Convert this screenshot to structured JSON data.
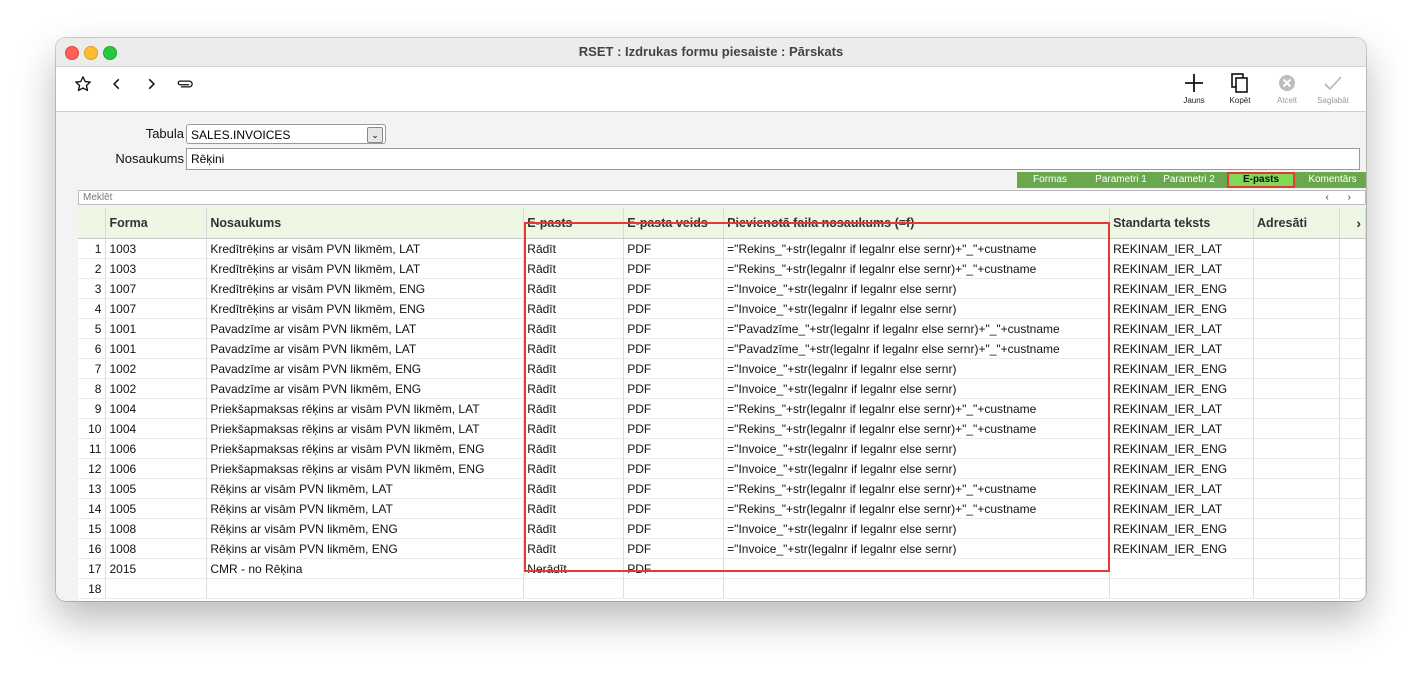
{
  "window": {
    "title": "RSET : Izdrukas formu piesaiste : Pārskats"
  },
  "toolbar": {
    "left_icons": [
      "star-icon",
      "chevron-left-icon",
      "chevron-right-icon",
      "paperclip-icon"
    ],
    "buttons": [
      {
        "label": "Jauns",
        "icon": "plus-icon",
        "enabled": true
      },
      {
        "label": "Kopēt",
        "icon": "copy-icon",
        "enabled": true
      },
      {
        "label": "Atcelt",
        "icon": "cancel-icon",
        "enabled": false
      },
      {
        "label": "Saglabāt",
        "icon": "check-icon",
        "enabled": false
      }
    ]
  },
  "form": {
    "table_label": "Tabula",
    "table_value": "SALES.INVOICES",
    "name_label": "Nosaukums",
    "name_value": "Rēķini"
  },
  "tabs": [
    {
      "label": "Formas",
      "active": false
    },
    {
      "label": "Parametri 1",
      "active": false
    },
    {
      "label": "Parametri 2",
      "active": false
    },
    {
      "label": "E-pasts",
      "active": true
    },
    {
      "label": "Komentārs",
      "active": false
    }
  ],
  "search": {
    "placeholder": "Meklēt",
    "nav": "‹ ›"
  },
  "colors": {
    "tab_bar": "#6aa84f",
    "tab_active": "#7ed957",
    "highlight": "#e53935",
    "header_bg": "#eef7e4"
  },
  "grid": {
    "columns": [
      "",
      "Forma",
      "Nosaukums",
      "E-pasts",
      "E-pasta veids",
      "Pievienotā faila nosaukums (=f)",
      "Standarta teksts",
      "Adresāti",
      "›"
    ],
    "rows": [
      [
        "1",
        "1003",
        "Kredītrēķins ar visām PVN likmēm, LAT",
        "Rādīt",
        "PDF",
        "=\"Rekins_\"+str(legalnr if legalnr else sernr)+\"_\"+custname",
        "REKINAM_IER_LAT",
        ""
      ],
      [
        "2",
        "1003",
        "Kredītrēķins ar visām PVN likmēm, LAT",
        "Rādīt",
        "PDF",
        "=\"Rekins_\"+str(legalnr if legalnr else sernr)+\"_\"+custname",
        "REKINAM_IER_LAT",
        ""
      ],
      [
        "3",
        "1007",
        "Kredītrēķins ar visām PVN likmēm, ENG",
        "Rādīt",
        "PDF",
        "=\"Invoice_\"+str(legalnr if legalnr else sernr)",
        "REKINAM_IER_ENG",
        ""
      ],
      [
        "4",
        "1007",
        "Kredītrēķins ar visām PVN likmēm, ENG",
        "Rādīt",
        "PDF",
        "=\"Invoice_\"+str(legalnr if legalnr else sernr)",
        "REKINAM_IER_ENG",
        ""
      ],
      [
        "5",
        "1001",
        "Pavadzīme ar visām PVN likmēm, LAT",
        "Rādīt",
        "PDF",
        "=\"Pavadzīme_\"+str(legalnr if legalnr else sernr)+\"_\"+custname",
        "REKINAM_IER_LAT",
        ""
      ],
      [
        "6",
        "1001",
        "Pavadzīme ar visām PVN likmēm, LAT",
        "Rādīt",
        "PDF",
        "=\"Pavadzīme_\"+str(legalnr if legalnr else sernr)+\"_\"+custname",
        "REKINAM_IER_LAT",
        ""
      ],
      [
        "7",
        "1002",
        "Pavadzīme ar visām PVN likmēm, ENG",
        "Rādīt",
        "PDF",
        "=\"Invoice_\"+str(legalnr if legalnr else sernr)",
        "REKINAM_IER_ENG",
        ""
      ],
      [
        "8",
        "1002",
        "Pavadzīme ar visām PVN likmēm, ENG",
        "Rādīt",
        "PDF",
        "=\"Invoice_\"+str(legalnr if legalnr else sernr)",
        "REKINAM_IER_ENG",
        ""
      ],
      [
        "9",
        "1004",
        "Priekšapmaksas rēķins ar visām PVN likmēm, LAT",
        "Rādīt",
        "PDF",
        "=\"Rekins_\"+str(legalnr if legalnr else sernr)+\"_\"+custname",
        "REKINAM_IER_LAT",
        ""
      ],
      [
        "10",
        "1004",
        "Priekšapmaksas rēķins ar visām PVN likmēm, LAT",
        "Rādīt",
        "PDF",
        "=\"Rekins_\"+str(legalnr if legalnr else sernr)+\"_\"+custname",
        "REKINAM_IER_LAT",
        ""
      ],
      [
        "11",
        "1006",
        "Priekšapmaksas rēķins ar visām PVN likmēm, ENG",
        "Rādīt",
        "PDF",
        "=\"Invoice_\"+str(legalnr if legalnr else sernr)",
        "REKINAM_IER_ENG",
        ""
      ],
      [
        "12",
        "1006",
        "Priekšapmaksas rēķins ar visām PVN likmēm, ENG",
        "Rādīt",
        "PDF",
        "=\"Invoice_\"+str(legalnr if legalnr else sernr)",
        "REKINAM_IER_ENG",
        ""
      ],
      [
        "13",
        "1005",
        "Rēķins ar visām PVN likmēm, LAT",
        "Rādīt",
        "PDF",
        "=\"Rekins_\"+str(legalnr if legalnr else sernr)+\"_\"+custname",
        "REKINAM_IER_LAT",
        ""
      ],
      [
        "14",
        "1005",
        "Rēķins ar visām PVN likmēm, LAT",
        "Rādīt",
        "PDF",
        "=\"Rekins_\"+str(legalnr if legalnr else sernr)+\"_\"+custname",
        "REKINAM_IER_LAT",
        ""
      ],
      [
        "15",
        "1008",
        "Rēķins ar visām PVN likmēm, ENG",
        "Rādīt",
        "PDF",
        "=\"Invoice_\"+str(legalnr if legalnr else sernr)",
        "REKINAM_IER_ENG",
        ""
      ],
      [
        "16",
        "1008",
        "Rēķins ar visām PVN likmēm, ENG",
        "Rādīt",
        "PDF",
        "=\"Invoice_\"+str(legalnr if legalnr else sernr)",
        "REKINAM_IER_ENG",
        ""
      ],
      [
        "17",
        "2015",
        "CMR - no Rēķina",
        "Nerādīt",
        "PDF",
        "",
        "",
        ""
      ],
      [
        "18",
        "",
        "",
        "",
        "",
        "",
        "",
        ""
      ]
    ]
  }
}
